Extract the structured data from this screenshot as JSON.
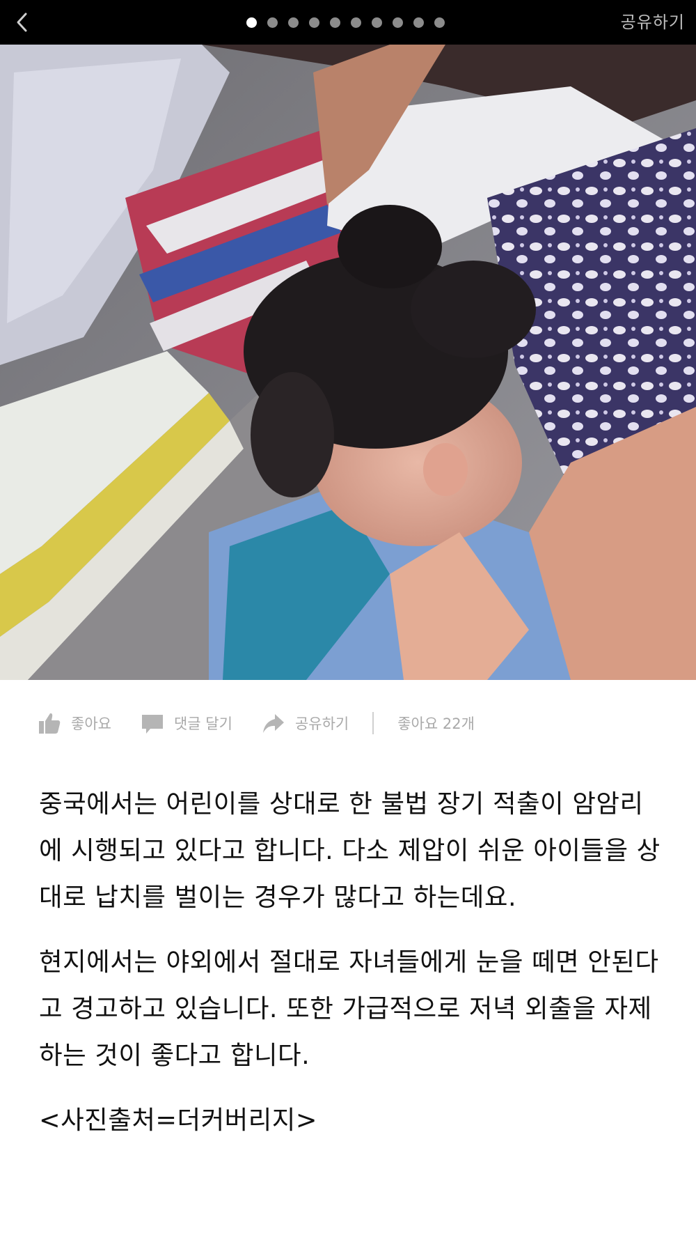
{
  "header": {
    "back_icon": "chevron-left-icon",
    "share_label": "공유하기",
    "pagination": {
      "total": 10,
      "current": 1
    }
  },
  "photo": {
    "description_icon": "photo"
  },
  "actions": {
    "like_label": "좋아요",
    "comment_label": "댓글 달기",
    "share_label": "공유하기",
    "likes_count_label": "좋아요 22개"
  },
  "article": {
    "paragraph_1": "중국에서는 어린이를 상대로 한 불법 장기 적출이 암암리에 시행되고 있다고 합니다. 다소 제압이 쉬운 아이들을 상대로 납치를 벌이는 경우가 많다고 하는데요.",
    "paragraph_2": "현지에서는 야외에서 절대로 자녀들에게 눈을 떼면 안된다고 경고하고 있습니다. 또한 가급적으로 저녁 외출을 자제하는 것이 좋다고 합니다.",
    "source": "<사진출처=더커버리지>"
  },
  "colors": {
    "topbar_bg": "#000000",
    "action_text": "#a9a9a9",
    "body_text": "#111111"
  }
}
